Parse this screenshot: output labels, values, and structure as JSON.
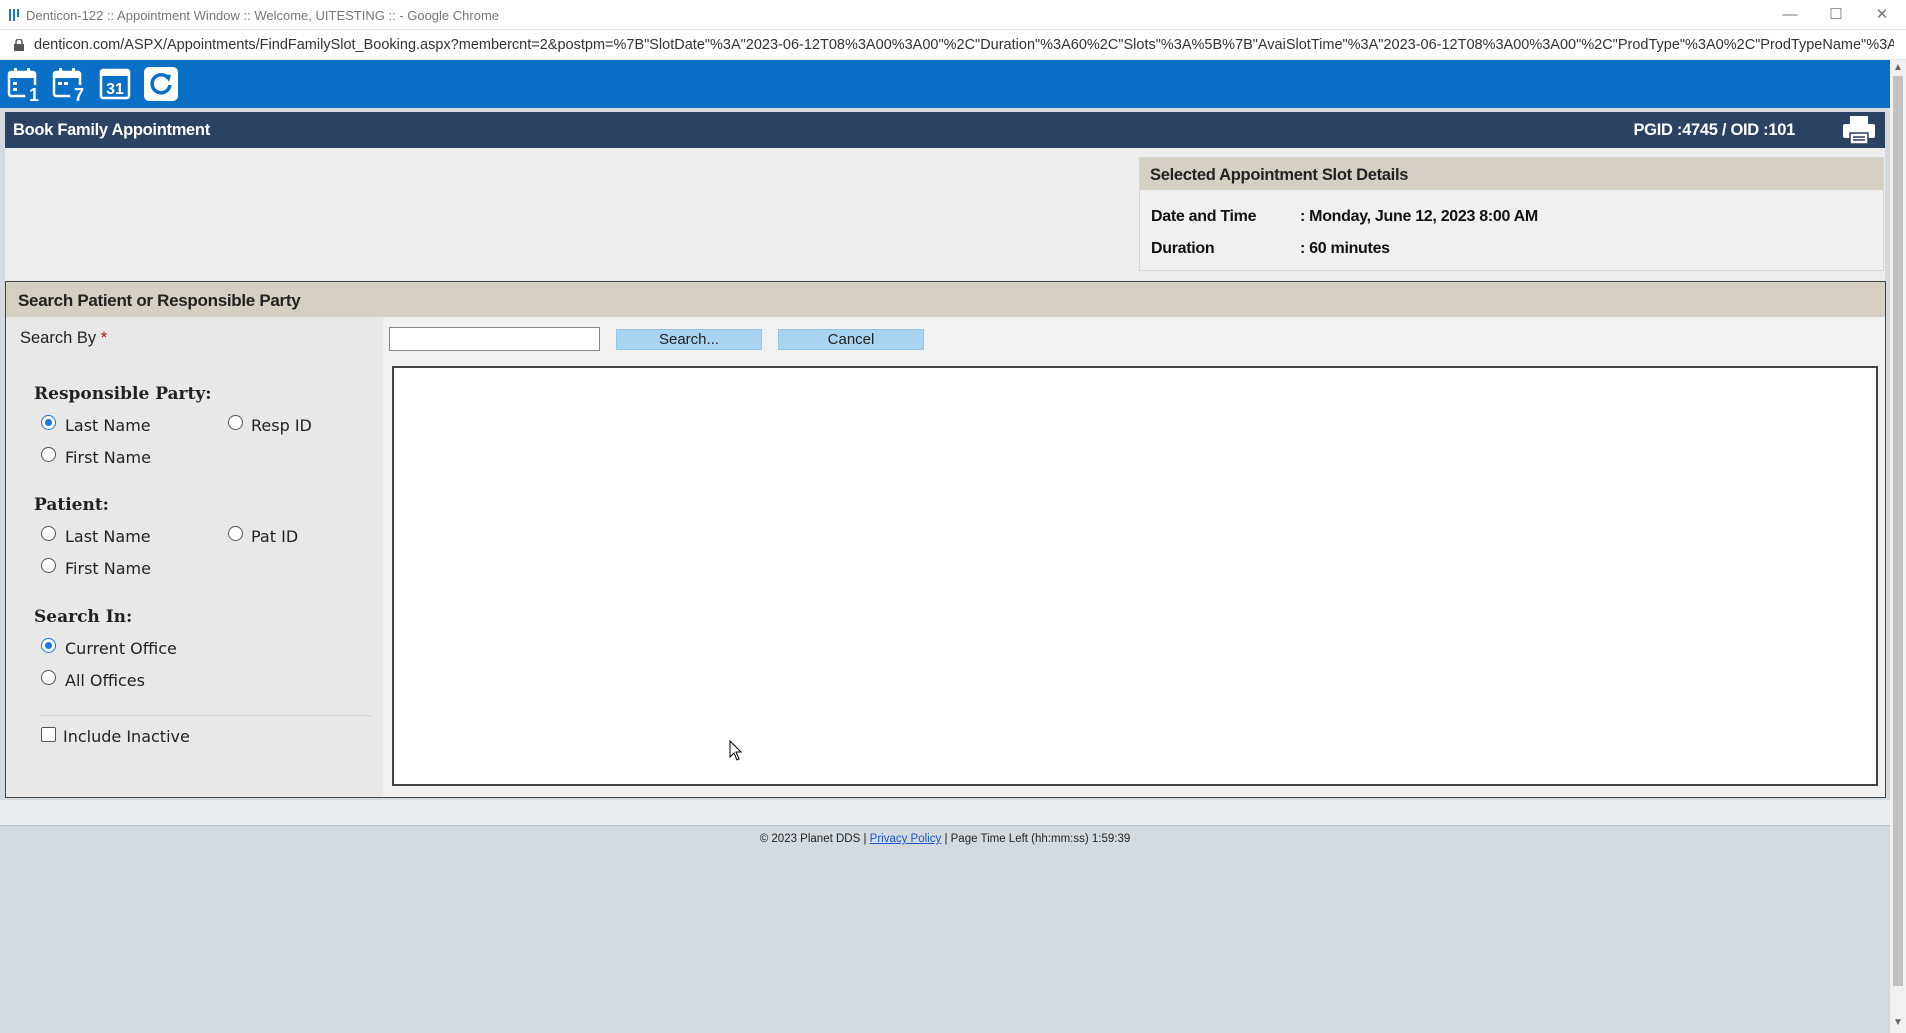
{
  "window": {
    "title": "Denticon-122 :: Appointment Window :: Welcome, UITESTING :: - Google Chrome",
    "url": "denticon.com/ASPX/Appointments/FindFamilySlot_Booking.aspx?membercnt=2&postpm=%7B\"SlotDate\"%3A\"2023-06-12T08%3A00%3A00\"%2C\"Duration\"%3A60%2C\"Slots\"%3A%5B%7B\"AvaiSlotTime\"%3A\"2023-06-12T08%3A00%3A00\"%2C\"ProdType\"%3A0%2C\"ProdTypeName\"%3A\"\"%2C\"OpId\"..."
  },
  "toolbar": {
    "buttons": [
      {
        "icon": "calendar-day-icon",
        "badge": "1"
      },
      {
        "icon": "calendar-week-icon",
        "badge": "7"
      },
      {
        "icon": "calendar-month-icon",
        "badge": "31"
      },
      {
        "icon": "refresh-icon"
      }
    ]
  },
  "header": {
    "title": "Book Family Appointment",
    "ids": "PGID :4745  /  OID :101"
  },
  "slot_details": {
    "heading": "Selected Appointment Slot Details",
    "date_label": "Date and Time",
    "date_value": ": Monday, June 12, 2023 8:00 AM",
    "duration_label": "Duration",
    "duration_value": ": 60 minutes"
  },
  "search": {
    "heading": "Search Patient or Responsible Party",
    "search_by_label": "Search By",
    "required_mark": "*",
    "input_value": "",
    "search_button": "Search...",
    "cancel_button": "Cancel"
  },
  "options": {
    "responsible_party": {
      "title": "Responsible Party:",
      "last_name": "Last Name",
      "resp_id": "Resp ID",
      "first_name": "First Name",
      "selected": "last_name"
    },
    "patient": {
      "title": "Patient:",
      "last_name": "Last Name",
      "pat_id": "Pat ID",
      "first_name": "First Name"
    },
    "search_in": {
      "title": "Search In:",
      "current_office": "Current Office",
      "all_offices": "All Offices",
      "selected": "current_office"
    },
    "include_inactive": {
      "label": "Include Inactive",
      "checked": false
    }
  },
  "footer": {
    "copyright": "© 2023 Planet DDS |",
    "privacy_link": "Privacy Policy",
    "separator": "|",
    "time_left_label": "Page Time Left (hh:mm:ss)",
    "time_left_value": "1:59:39"
  },
  "colors": {
    "toolbar_blue": "#0a6fc6",
    "header_navy": "#2b4363",
    "panel_tan": "#d6d0c4",
    "button_blue": "#a8d4f2"
  }
}
